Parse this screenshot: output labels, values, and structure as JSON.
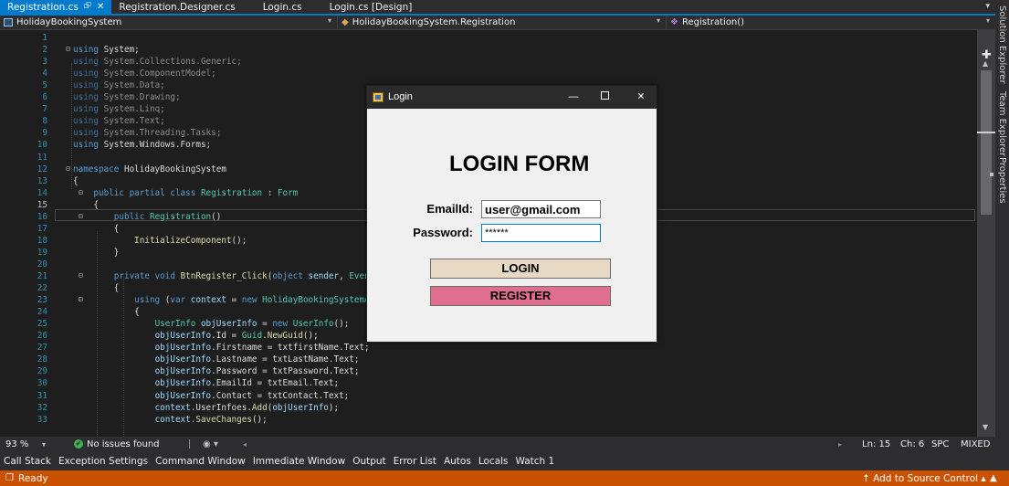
{
  "tabs": [
    {
      "label": "Registration.cs",
      "active": true
    },
    {
      "label": "Registration.Designer.cs"
    },
    {
      "label": "Login.cs"
    },
    {
      "label": "Login.cs [Design]"
    }
  ],
  "tab_pin": "⮺",
  "tab_close": "✕",
  "nav": {
    "project": "HolidayBookingSystem",
    "type": "HolidayBookingSystem.Registration",
    "member": "Registration()"
  },
  "code": {
    "lines": [
      {
        "n": "1",
        "html": ""
      },
      {
        "n": "2",
        "html": "<span class=\"k\">using</span> System;"
      },
      {
        "n": "3",
        "html": "<span class=\"dimk\">using</span> <span class=\"dim\">System.Collections.Generic;</span>"
      },
      {
        "n": "4",
        "html": "<span class=\"dimk\">using</span> <span class=\"dim\">System.ComponentModel;</span>"
      },
      {
        "n": "5",
        "html": "<span class=\"dimk\">using</span> <span class=\"dim\">System.Data;</span>"
      },
      {
        "n": "6",
        "html": "<span class=\"dimk\">using</span> <span class=\"dim\">System.Drawing;</span>"
      },
      {
        "n": "7",
        "html": "<span class=\"dimk\">using</span> <span class=\"dim\">System.Linq;</span>"
      },
      {
        "n": "8",
        "html": "<span class=\"dimk\">using</span> <span class=\"dim\">System.Text;</span>"
      },
      {
        "n": "9",
        "html": "<span class=\"dimk\">using</span> <span class=\"dim\">System.Threading.Tasks;</span>"
      },
      {
        "n": "10",
        "html": "<span class=\"k\">using</span> System.Windows.Forms;"
      },
      {
        "n": "11",
        "html": ""
      },
      {
        "n": "12",
        "html": "<span class=\"k\">namespace</span> HolidayBookingSystem"
      },
      {
        "n": "13",
        "html": "{"
      },
      {
        "n": "14",
        "html": "    <span class=\"k\">public partial class</span> <span class=\"t\">Registration</span> : <span class=\"t\">Form</span>"
      },
      {
        "n": "15",
        "html": "    {"
      },
      {
        "n": "16",
        "html": "        <span class=\"k\">public</span> <span class=\"t\">Registration</span>()"
      },
      {
        "n": "17",
        "html": "        {"
      },
      {
        "n": "18",
        "html": "            <span class=\"m\">InitializeComponent</span>();"
      },
      {
        "n": "19",
        "html": "        }"
      },
      {
        "n": "20",
        "html": ""
      },
      {
        "n": "21",
        "html": "        <span class=\"k\">private void</span> <span class=\"m\">BtnRegister_Click</span>(<span class=\"k\">object</span> <span class=\"v\">sender</span>, <span class=\"t\">EventA</span>"
      },
      {
        "n": "22",
        "html": "        {"
      },
      {
        "n": "23",
        "html": "            <span class=\"k\">using</span> (<span class=\"k\">var</span> <span class=\"v\">context</span> = <span class=\"k\">new</span> <span class=\"t\">HolidayBookingSystemApp</span>"
      },
      {
        "n": "24",
        "html": "            {"
      },
      {
        "n": "25",
        "html": "                <span class=\"t\">UserInfo</span> <span class=\"v\">objUserInfo</span> = <span class=\"k\">new</span> <span class=\"t\">UserInfo</span>();"
      },
      {
        "n": "26",
        "html": "                <span class=\"v\">objUserInfo</span>.Id = <span class=\"t\">Guid</span>.<span class=\"m\">NewGuid</span>();"
      },
      {
        "n": "27",
        "html": "                <span class=\"v\">objUserInfo</span>.Firstname = txtfirstName.Text;"
      },
      {
        "n": "28",
        "html": "                <span class=\"v\">objUserInfo</span>.Lastname = txtLastName.Text;"
      },
      {
        "n": "29",
        "html": "                <span class=\"v\">objUserInfo</span>.Password = txtPassword.Text;"
      },
      {
        "n": "30",
        "html": "                <span class=\"v\">objUserInfo</span>.EmailId = txtEmail.Text;"
      },
      {
        "n": "31",
        "html": "                <span class=\"v\">objUserInfo</span>.Contact = txtContact.Text;"
      },
      {
        "n": "32",
        "html": "                <span class=\"v\">context</span>.UserInfoes.<span class=\"m\">Add</span>(<span class=\"v\">objUserInfo</span>);"
      },
      {
        "n": "33",
        "html": "                <span class=\"v\">context</span>.<span class=\"m\">SaveChanges</span>();"
      }
    ]
  },
  "side_tabs": [
    "Solution Explorer",
    "Team Explorer",
    "Properties"
  ],
  "editor_status": {
    "zoom": "93 %",
    "issues": "No issues found",
    "ln": "Ln: 15",
    "ch": "Ch: 6",
    "spc": "SPC",
    "eol": "MIXED"
  },
  "tool_tabs": [
    "Call Stack",
    "Exception Settings",
    "Command Window",
    "Immediate Window",
    "Output",
    "Error List",
    "Autos",
    "Locals",
    "Watch 1"
  ],
  "status": {
    "ready": "Ready",
    "source_control": "↑  Add to Source Control ▴",
    "color": "#ca5100"
  },
  "login_dialog": {
    "title": "Login",
    "heading": "LOGIN FORM",
    "email_label": "EmailId:",
    "email_value": "user@gmail.com",
    "password_label": "Password:",
    "password_value": "******",
    "login_button": "LOGIN",
    "register_button": "REGISTER",
    "colors": {
      "login": "#e8d9c5",
      "register": "#e06e8f",
      "titlebar": "#2b2b2b"
    }
  },
  "icons": {
    "check": "✔",
    "dropdown": "▾",
    "close": "✕",
    "minimize": "—",
    "plus": "✚",
    "brush": "◉ ▾",
    "ready": "❐",
    "bell": "▲",
    "left": "◂",
    "right": "▸",
    "up": "▲",
    "down": "▼"
  }
}
